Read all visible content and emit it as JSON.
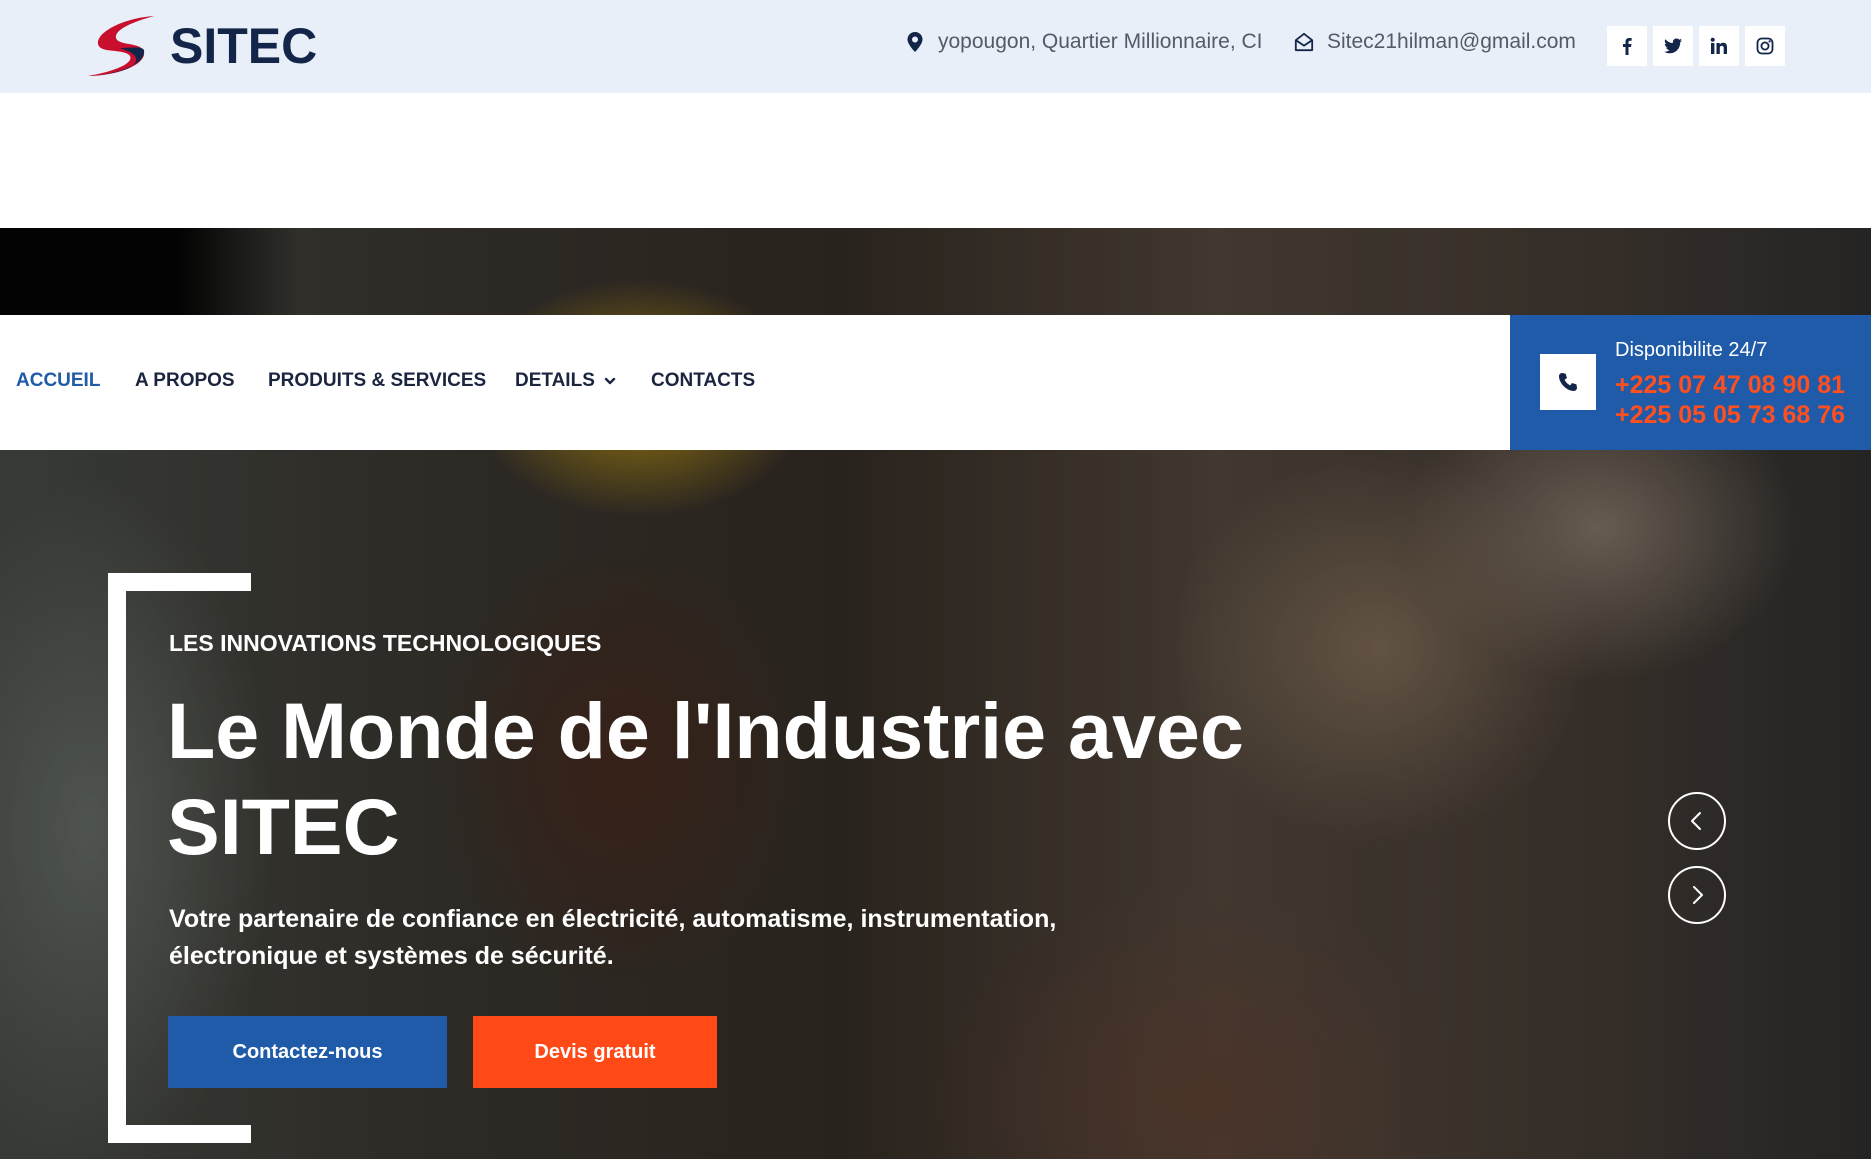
{
  "brand": {
    "name": "SITEC"
  },
  "topbar": {
    "address": "yopougon, Quartier Millionnaire, CI",
    "email": "Sitec21hilman@gmail.com",
    "socials": [
      "facebook-icon",
      "twitter-icon",
      "linkedin-icon",
      "instagram-icon"
    ]
  },
  "nav": {
    "items": [
      {
        "label": "ACCUEIL",
        "active": true
      },
      {
        "label": "A PROPOS"
      },
      {
        "label": "PRODUITS & SERVICES"
      },
      {
        "label": "DETAILS",
        "has_dropdown": true
      },
      {
        "label": "CONTACTS"
      }
    ]
  },
  "callbox": {
    "availability": "Disponibilite 24/7",
    "phone_1": "+225 07 47 08 90 81",
    "phone_2": "+225 05 05 73 68 76"
  },
  "hero": {
    "eyebrow": "LES INNOVATIONS TECHNOLOGIQUES",
    "title": "Le Monde de l'Industrie avec SITEC",
    "subtitle": "Votre partenaire de confiance en électricité, automatisme, instrumentation, électronique et systèmes de sécurité.",
    "cta_primary": "Contactez-nous",
    "cta_secondary": "Devis gratuit"
  },
  "colors": {
    "primary_blue": "#1f5ba8",
    "accent_orange": "#ff4a17",
    "phone_orange": "#ff4f1f",
    "topbar_bg": "#e9eff8",
    "dark_navy": "#13264a"
  }
}
